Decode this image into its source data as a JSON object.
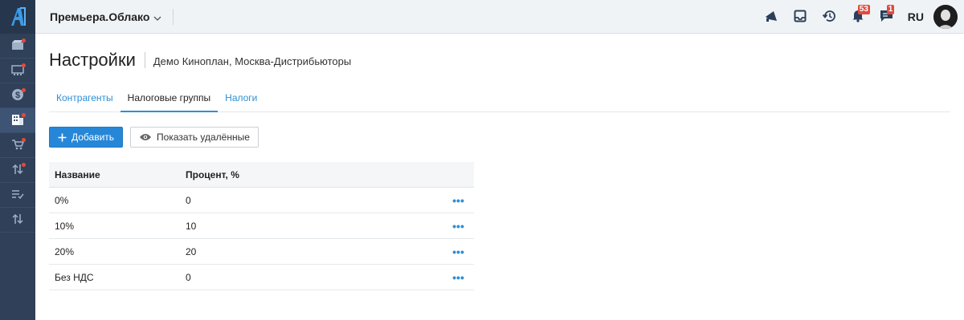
{
  "app": {
    "org_name": "Премьера.Облако",
    "lang": "RU",
    "notifications_count": "53",
    "messages_count": "1"
  },
  "sidebar": {
    "items": [
      {
        "icon": "film-icon",
        "dot": true
      },
      {
        "icon": "cinema-icon",
        "dot": true
      },
      {
        "icon": "dollar-icon",
        "dot": true
      },
      {
        "icon": "building-icon",
        "dot": true,
        "active": true
      },
      {
        "icon": "cart-icon",
        "dot": true
      },
      {
        "icon": "transfer-icon",
        "dot": true
      },
      {
        "icon": "checklist-icon",
        "dot": false
      },
      {
        "icon": "sort-icon",
        "dot": false
      }
    ]
  },
  "page": {
    "title": "Настройки",
    "subtitle": "Демо Киноплан, Москва-Дистрибьюторы"
  },
  "tabs": [
    {
      "label": "Контрагенты",
      "active": false
    },
    {
      "label": "Налоговые группы",
      "active": true
    },
    {
      "label": "Налоги",
      "active": false
    }
  ],
  "toolbar": {
    "add_label": "Добавить",
    "show_deleted_label": "Показать удалённые"
  },
  "table": {
    "columns": [
      "Название",
      "Процент, %"
    ],
    "rows": [
      {
        "name": "0%",
        "percent": "0"
      },
      {
        "name": "10%",
        "percent": "10"
      },
      {
        "name": "20%",
        "percent": "20"
      },
      {
        "name": "Без НДС",
        "percent": "0"
      }
    ],
    "row_action": "•••"
  },
  "colors": {
    "sidebar_bg": "#2f4058",
    "accent": "#2d8fd5",
    "primary_button": "#2687d8",
    "badge": "#e34a3c"
  }
}
